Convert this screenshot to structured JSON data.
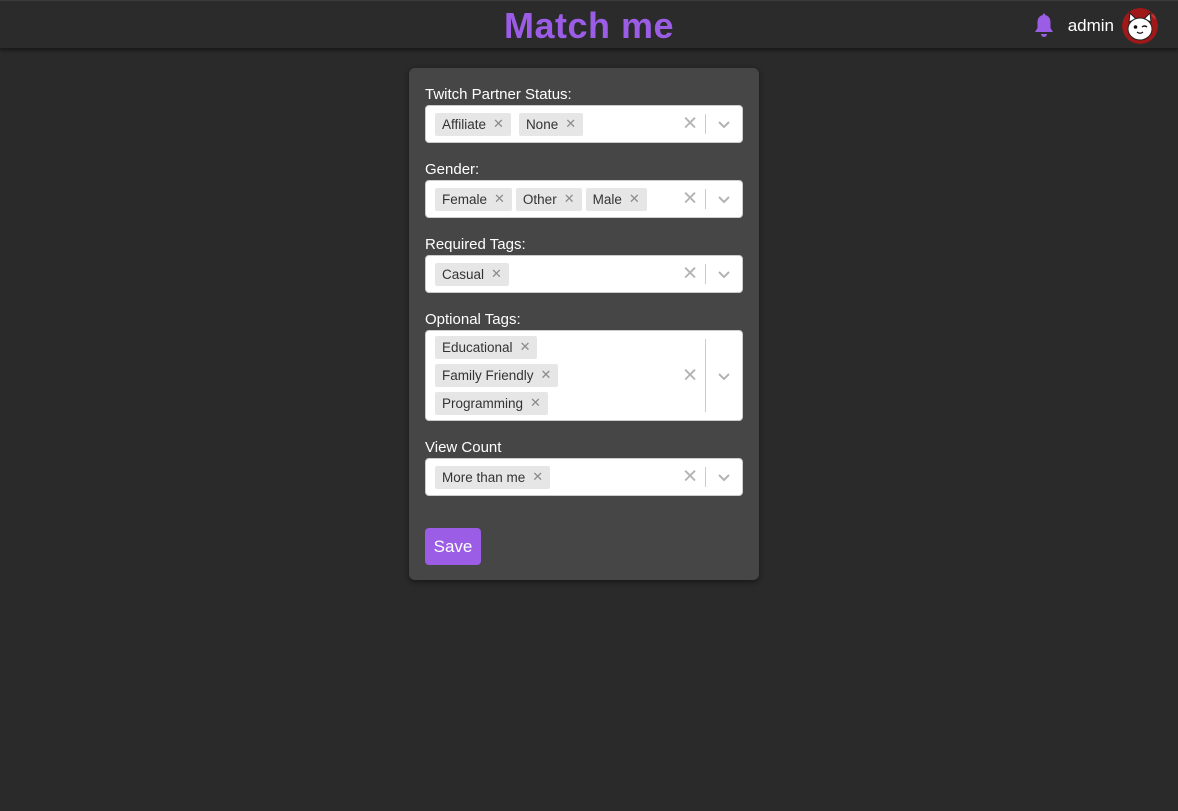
{
  "header": {
    "brand": "Match me",
    "username": "admin",
    "bell_icon": "bell-icon",
    "accent_color": "#9b5de5"
  },
  "form": {
    "fields": [
      {
        "label": "Twitch Partner Status:",
        "values": [
          "Affiliate",
          "None"
        ]
      },
      {
        "label": "Gender:",
        "values": [
          "Female",
          "Other",
          "Male"
        ]
      },
      {
        "label": "Required Tags:",
        "values": [
          "Casual"
        ]
      },
      {
        "label": "Optional Tags:",
        "values": [
          "Educational",
          "Family Friendly",
          "Programming"
        ]
      },
      {
        "label": "View Count",
        "values": [
          "More than me"
        ]
      }
    ],
    "save_label": "Save"
  }
}
